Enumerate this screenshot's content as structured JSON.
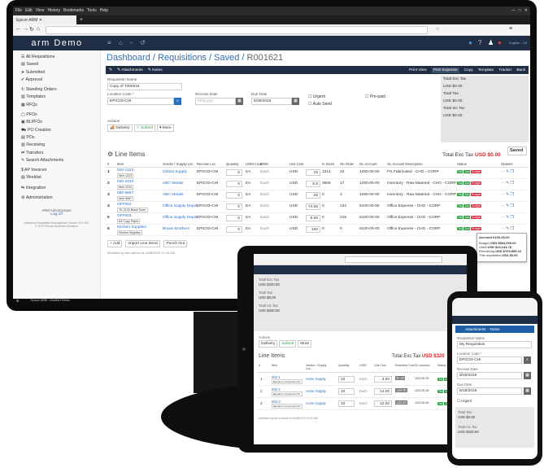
{
  "browser": {
    "menu": [
      "File",
      "Edit",
      "View",
      "History",
      "Bookmarks",
      "Tools",
      "Help"
    ],
    "tab_title": "Epicor ARM",
    "window_controls": [
      "—",
      "□",
      "✕"
    ]
  },
  "app": {
    "logo": "arm Demo",
    "user": "English - US"
  },
  "sidebar": {
    "items": [
      {
        "icon": "list-icon",
        "label": "All Requisitions"
      },
      {
        "icon": "save-icon",
        "label": "Saved"
      },
      {
        "icon": "submit-icon",
        "label": "Submitted"
      },
      {
        "icon": "approve-icon",
        "label": "Approval"
      },
      {
        "icon": "refresh-icon",
        "label": "Standing Orders",
        "section": true
      },
      {
        "icon": "template-icon",
        "label": "Templates"
      },
      {
        "icon": "rfq-icon",
        "label": "RFQs"
      },
      {
        "icon": "pfo-icon",
        "label": "PFOs",
        "section": true
      },
      {
        "icon": "blpfo-icon",
        "label": "BLPFOs"
      },
      {
        "icon": "truck-icon",
        "label": "PO Creation"
      },
      {
        "icon": "po-icon",
        "label": "POs"
      },
      {
        "icon": "receiving-icon",
        "label": "Receiving"
      },
      {
        "icon": "transfer-icon",
        "label": "Transfers"
      },
      {
        "icon": "attach-icon",
        "label": "Search Attachments"
      },
      {
        "icon": "dollar-icon",
        "label": "AP Invoices",
        "section": true
      },
      {
        "icon": "worklist-icon",
        "label": "Worklist"
      },
      {
        "icon": "integration-icon",
        "label": "Integration",
        "section": true
      },
      {
        "icon": "admin-icon",
        "label": "Administration",
        "section": true
      }
    ],
    "footer_user": "ARM Administrator",
    "logout": "Log off",
    "version": "Advanced Requisition Management Version 10.2.300",
    "copyright": "© 2019 Precise Business Solutions"
  },
  "breadcrumb": {
    "part1": "Dashboard",
    "part2": "Requisitions",
    "part3": "Saved",
    "part4": "R001621",
    "sep": "/"
  },
  "toolbar": {
    "attachments": "✎ Attachments",
    "notes": "✎ Notes",
    "print": "Print View",
    "print_exp": "Print Expense",
    "copy": "Copy",
    "template": "Template",
    "tracker": "Tracker",
    "back": "Back"
  },
  "form": {
    "req_name_label": "Requisition Name",
    "req_name": "Copy of T000044",
    "location_label": "Location Code *",
    "location": "EPIC03-CHI",
    "receive_label": "Receive Date",
    "receive_placeholder": "M/d/yyyy",
    "due_label": "Due Date",
    "due": "8/28/2019",
    "urgent": "Urgent",
    "autosend": "Auto Send",
    "prepaid": "Pre-paid",
    "actions_label": "Actions",
    "delivery": "Delivery",
    "submit": "Submit",
    "more": "More",
    "save": "Saved"
  },
  "tax": {
    "exc_label": "Total Exc Tax",
    "exc": "USD $0.00",
    "tax_label": "Total Tax",
    "tax": "USD $0.00",
    "inc_label": "Total Inc Tax",
    "inc": "USD $0.00"
  },
  "lines": {
    "title": "Line Items",
    "total_label": "Total Exc Tax",
    "total": "USD $0.00",
    "headers": [
      "#",
      "Item",
      "Vendor / Supply Loc.",
      "Receive Loc.",
      "Quantity",
      "UOM Code",
      "UOM",
      "Unit Cost",
      "In Stock",
      "On Order",
      "GL Account",
      "GL Account Description",
      "Status",
      "Options"
    ],
    "rows": [
      {
        "n": "1",
        "item": "020-1223",
        "desc": "Item 1223",
        "vendor": "Global Supply",
        "rec": "EPIC03-CHI",
        "qty": "0",
        "uomc": "EA",
        "uom": "Each",
        "cur": "USD",
        "cost": "15",
        "stock": "1314",
        "order": "10",
        "gl": "1250-00-00",
        "gldesc": "FG Fabricated - CHG - CORP"
      },
      {
        "n": "2",
        "item": "030-2234",
        "desc": "Item 2234",
        "vendor": "ABC Metals",
        "rec": "EPIC03-CHI",
        "qty": "0",
        "uomc": "EA",
        "uom": "Each",
        "cur": "USD",
        "cost": "6.5",
        "stock": "3666",
        "order": "17",
        "gl": "1250-00-00",
        "gldesc": "Inventory - Raw Material - CHG - CORP"
      },
      {
        "n": "3",
        "item": "060-5667",
        "desc": "Item 5667",
        "vendor": "ABC Metals",
        "rec": "EPIC03-CHI",
        "qty": "0",
        "uomc": "EA",
        "uom": "Each",
        "cur": "USD",
        "cost": "25",
        "stock": "0",
        "order": "3",
        "gl": "1250-00-00",
        "gldesc": "Inventory - Raw Material - CHG - CORP"
      },
      {
        "n": "4",
        "item": "OFF002",
        "desc": "TK-3130 Black Toner",
        "vendor": "Office Supply Depot",
        "rec": "EPIC03-CHI",
        "qty": "0",
        "uomc": "EA",
        "uom": "Each",
        "cur": "USD",
        "cost": "74.55",
        "stock": "0",
        "order": "134",
        "gl": "6100-00-00",
        "gldesc": "Office Expense - CHG - CORP"
      },
      {
        "n": "5",
        "item": "OFF003",
        "desc": "A4 Copy Paper",
        "vendor": "Office Supply Depot",
        "rec": "EPIC03-CHI",
        "qty": "0",
        "uomc": "EA",
        "uom": "Each",
        "cur": "USD",
        "cost": "9.69",
        "stock": "0",
        "order": "215",
        "gl": "6100-00-00",
        "gldesc": "Office Expense - CHG - CORP"
      },
      {
        "n": "6",
        "item": "Kitchen Supplies",
        "desc": "Kitchen Supplies",
        "vendor": "Brown Brothers",
        "rec": "EPIC03-CHI",
        "qty": "0",
        "uomc": "EA",
        "uom": "Each",
        "cur": "USD",
        "cost": "100",
        "stock": "0",
        "order": "0",
        "gl": "6100-00-00",
        "gldesc": "Office Expense - CHG - CORP"
      }
    ],
    "footer_add": "+ Add",
    "footer_import": "Import Line Items",
    "footer_punch": "Punch Out",
    "modified": "Modified by arm-admin on 8/28/2019 10:15 AM"
  },
  "popup": {
    "title": "Account 6100-00-00",
    "budget_label": "Budget",
    "budget": "USD $804,000.00",
    "used_label": "Used",
    "used": "USD $24,144.78",
    "remain_label": "Remaining",
    "remain": "USD $769,855.22",
    "req_label": "This requisition",
    "req": "USD $0.00"
  },
  "badges": {
    "a": "Tax",
    "b": "Acc",
    "c": "Budget"
  },
  "taskbar": {
    "app": "Epicor ARM - Mozilla Firefox",
    "time": "10:11 AM",
    "date": "8/28/2019"
  },
  "tablet": {
    "exc_label": "Total Exc Tax",
    "exc": "USD $320.50",
    "tax_label": "Total Tax",
    "tax": "USD $0.00",
    "inc_label": "Total Inc Tax",
    "inc": "USD $320.50",
    "actions": "Actions",
    "delivery": "Delivery",
    "submit": "Submit",
    "more": "More",
    "title": "Line Items",
    "total_label": "Total Exc Tax",
    "total": "USD $320",
    "headers": [
      "#",
      "Item",
      "Vendor / Supply Loc.",
      "Quantity",
      "UOM",
      "Unit Cost",
      "Extended Cost",
      "GL Account",
      "Status"
    ],
    "rows": [
      {
        "n": "1",
        "item": "002-1",
        "desc": "Elevators Component Kit",
        "vendor": "Acme Supply",
        "qty": "10",
        "uom": "Each",
        "cost": "3.00",
        "ext": "30.00",
        "gl": "1210-00-00"
      },
      {
        "n": "2",
        "item": "002-2",
        "desc": "Elevators Component Kit",
        "vendor": "Acme Supply",
        "qty": "10",
        "uom": "Each",
        "cost": "14.00",
        "ext": "140.00",
        "gl": "1210-00-00"
      },
      {
        "n": "3",
        "item": "002-3",
        "desc": "Elevators Component Kit",
        "vendor": "Acme Supply",
        "qty": "10",
        "uom": "Each",
        "cost": "12.00",
        "ext": "120.00",
        "gl": "1210-00-00"
      }
    ],
    "modified": "Modified by arm-admin on 8/28/2019 8:15 AM"
  },
  "phone": {
    "attachments": "Attachments",
    "notes": "Notes",
    "req_label": "Requisition Name",
    "req": "My Requisition",
    "loc_label": "Location Code *",
    "loc": "EPIC03-CHI",
    "rec_label": "Receive Date",
    "rec": "8/18/2019",
    "due_label": "Due Date",
    "due": "8/18/2019",
    "urgent": "Urgent",
    "exc_label": "Total Tax",
    "exc": "USD $0.00",
    "inc_label": "Total Inc Tax",
    "inc": "USD $320.50"
  }
}
